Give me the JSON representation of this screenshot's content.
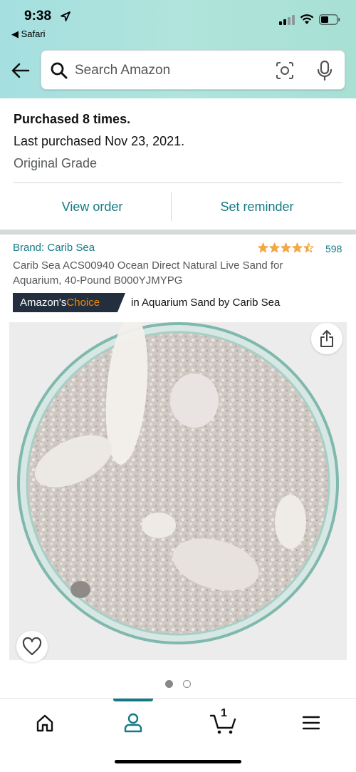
{
  "status_bar": {
    "time": "9:38",
    "back_app": "◀ Safari"
  },
  "search": {
    "placeholder": "Search Amazon"
  },
  "purchase_info": {
    "count_text": "Purchased 8 times.",
    "last_purchased": "Last purchased Nov 23, 2021.",
    "grade": "Original Grade"
  },
  "actions": {
    "view_order": "View order",
    "set_reminder": "Set reminder"
  },
  "product": {
    "brand": "Brand: Carib Sea",
    "rating": 4.5,
    "rating_count": "598",
    "title": "Carib Sea ACS00940 Ocean Direct Natural Live Sand for Aquarium, 40-Pound B000YJMYPG",
    "badge_prefix": "Amazon's ",
    "badge_highlight": "Choice",
    "badge_category": "in Aquarium Sand by Carib Sea",
    "image_count": 2,
    "current_image": 1
  },
  "bottom_nav": {
    "cart_count": "1",
    "items": [
      "home-icon",
      "account-icon",
      "cart-icon",
      "menu-icon"
    ]
  },
  "colors": {
    "accent": "#147a85",
    "star": "#f3a847",
    "badge_bg": "#232f3e",
    "badge_orange": "#f08804"
  }
}
